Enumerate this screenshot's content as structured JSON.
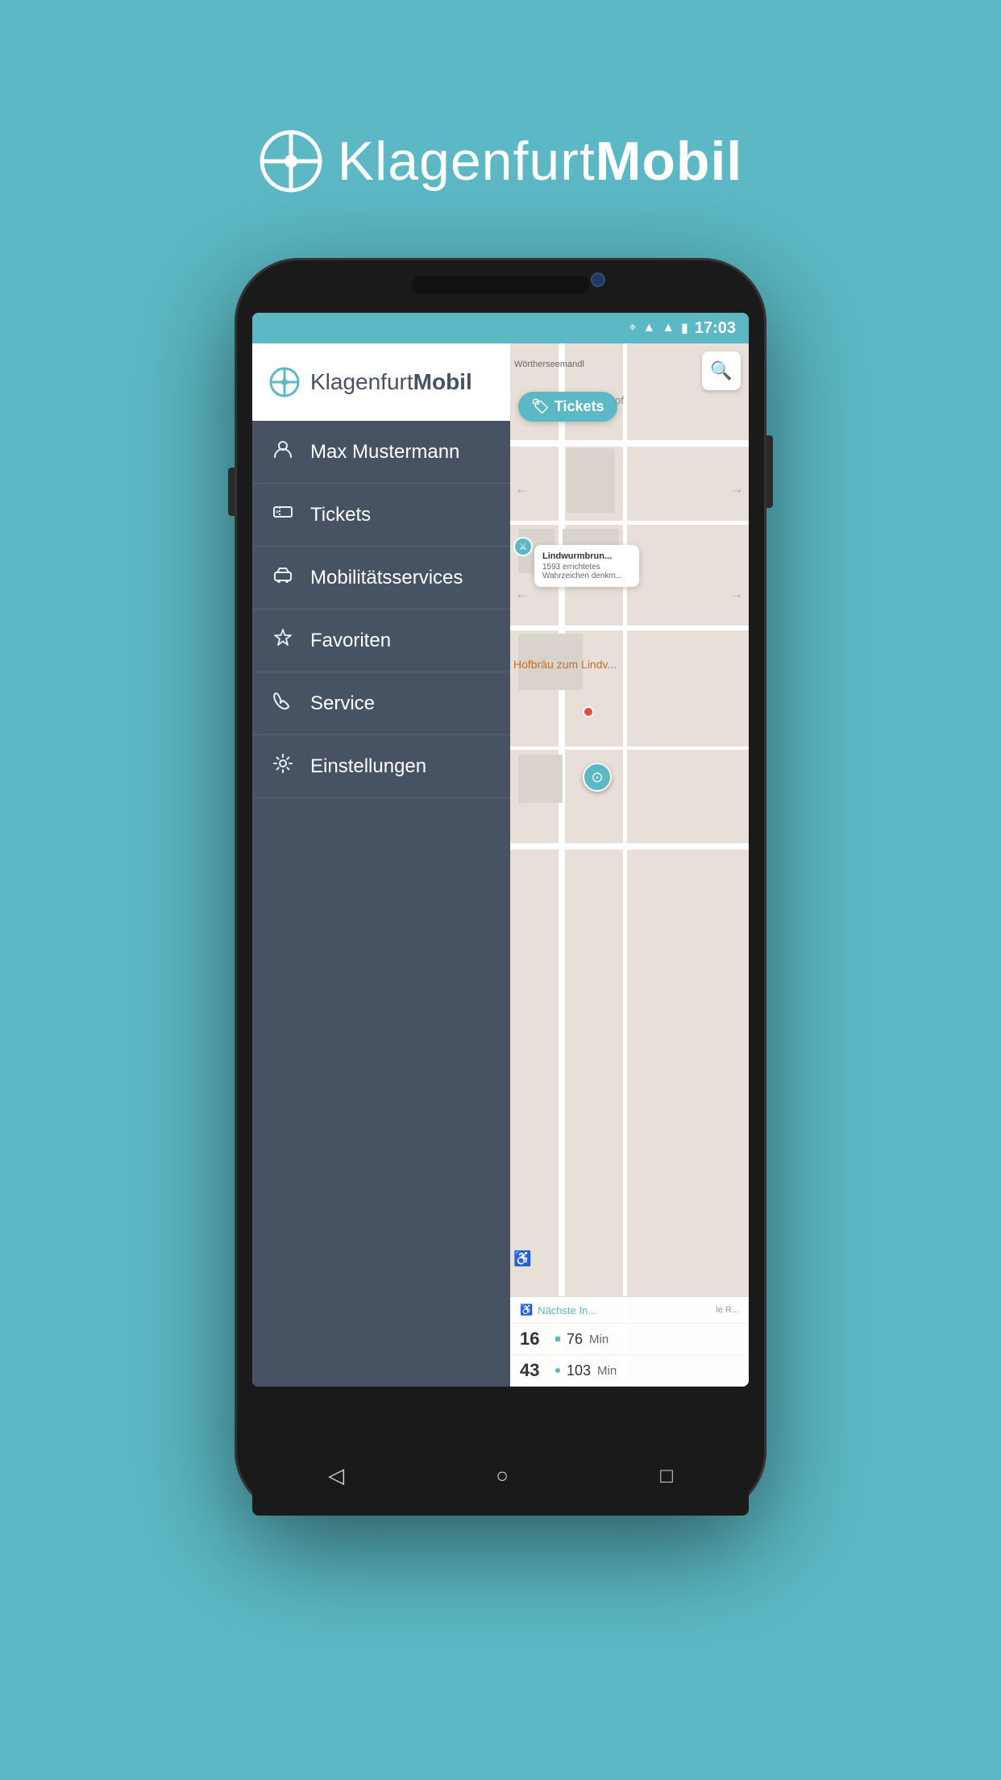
{
  "app": {
    "name": "KlagenfurtMobil",
    "name_light": "Klagenfurt",
    "name_bold": "Mobil"
  },
  "status_bar": {
    "time": "17:03",
    "icons": [
      "location",
      "wifi",
      "signal",
      "battery"
    ]
  },
  "drawer": {
    "logo_light": "Klagenfurt",
    "logo_bold": "Mobil",
    "items": [
      {
        "id": "user",
        "label": "Max Mustermann",
        "icon": "person"
      },
      {
        "id": "tickets",
        "label": "Tickets",
        "icon": "ticket"
      },
      {
        "id": "mobility",
        "label": "Mobilitätsservices",
        "icon": "car"
      },
      {
        "id": "favorites",
        "label": "Favoriten",
        "icon": "star"
      },
      {
        "id": "service",
        "label": "Service",
        "icon": "phone"
      },
      {
        "id": "settings",
        "label": "Einstellungen",
        "icon": "gear"
      }
    ]
  },
  "map": {
    "tickets_button": "Tickets",
    "tickets_of_label": "of",
    "map_label_1": "Wörtherseemandl",
    "map_label_2": "Lindwurmbrun...",
    "map_label_3": "1593 errichtetes\nWahrzeichen denkm...",
    "map_label_orange": "Hofbräu zum Lindv...",
    "bottom_panel": {
      "header": "Nächste In...",
      "rows": [
        {
          "line": "16",
          "minutes": "76",
          "unit": "Min"
        },
        {
          "line": "43",
          "minutes": "103",
          "unit": "Min"
        }
      ]
    }
  },
  "nav_bar": {
    "back": "◁",
    "home": "○",
    "recent": "□"
  }
}
